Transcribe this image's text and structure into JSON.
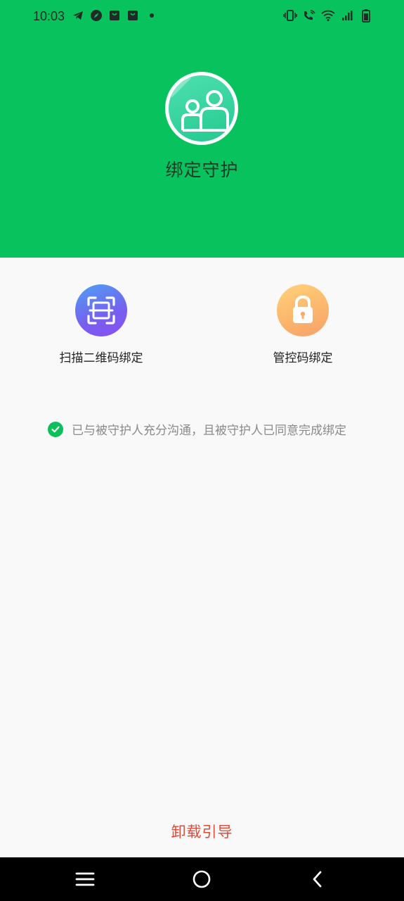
{
  "status_bar": {
    "time": "10:03",
    "left_icons": [
      "telegram-icon",
      "compass-icon",
      "shopping-bag-icon",
      "shopping-bag-icon",
      "dot-icon"
    ],
    "right_icons": [
      "vibrate-icon",
      "wifi-call-icon",
      "wifi-icon",
      "signal-icon",
      "battery-icon"
    ]
  },
  "header": {
    "title": "绑定守护",
    "color": "#08c35d",
    "avatar_icon": "parent-child-icon"
  },
  "options": [
    {
      "label": "扫描二维码绑定",
      "icon": "qr-scan-icon"
    },
    {
      "label": "管控码绑定",
      "icon": "lock-icon"
    }
  ],
  "agreement": {
    "text": "已与被守护人充分沟通，且被守护人已同意完成绑定",
    "checked": true
  },
  "footer": {
    "uninstall_label": "卸载引导",
    "color": "#dd4a3a"
  },
  "nav_bar": {
    "buttons": [
      "menu-icon",
      "home-icon",
      "back-icon"
    ]
  }
}
